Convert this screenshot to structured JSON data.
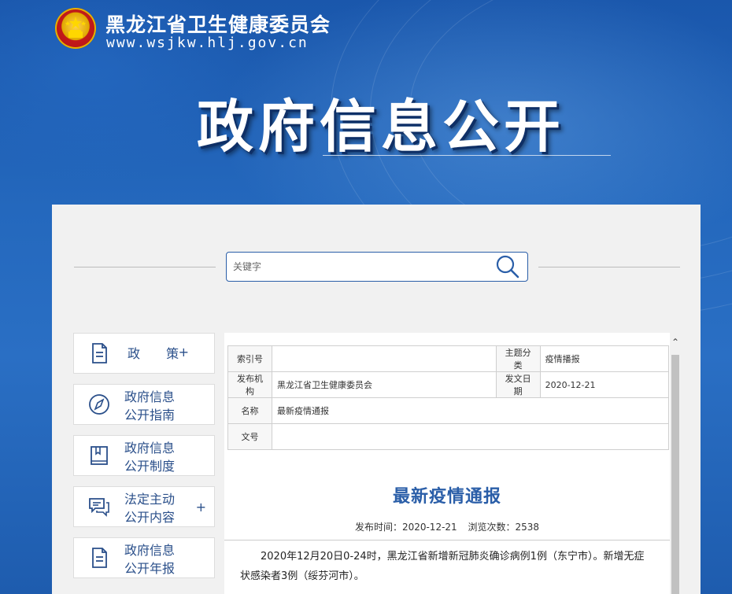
{
  "header": {
    "site_name": "黑龙江省卫生健康委员会",
    "site_url": "www.wsjkw.hlj.gov.cn",
    "page_heading": "政府信息公开"
  },
  "search": {
    "placeholder": "关键字"
  },
  "sidebar": {
    "items": [
      {
        "line1": "政 策",
        "plus": "+",
        "icon": "document-icon"
      },
      {
        "line1": "政府信息",
        "line2": "公开指南",
        "icon": "compass-icon"
      },
      {
        "line1": "政府信息",
        "line2": "公开制度",
        "icon": "book-icon"
      },
      {
        "line1": "法定主动",
        "line2": "公开内容",
        "plus": "+",
        "icon": "chat-icon"
      },
      {
        "line1": "政府信息",
        "line2": "公开年报",
        "icon": "document-icon"
      }
    ]
  },
  "meta_table": {
    "index_label": "索引号",
    "index_value": "",
    "topic_label": "主题分类",
    "topic_value": "疫情播报",
    "org_label": "发布机构",
    "org_value": "黑龙江省卫生健康委员会",
    "date_label": "发文日期",
    "date_value": "2020-12-21",
    "name_label": "名称",
    "name_value": "最新疫情通报",
    "docno_label": "文号",
    "docno_value": ""
  },
  "article": {
    "title": "最新疫情通报",
    "publish_time": "发布时间：2020-12-21",
    "views": "浏览次数：2538",
    "body": "2020年12月20日0-24时，黑龙江省新增新冠肺炎确诊病例1例（东宁市）。新增无症状感染者3例（绥芬河市）。"
  },
  "colors": {
    "brand_blue": "#1d5aa8",
    "accent": "#2a5ea8"
  }
}
